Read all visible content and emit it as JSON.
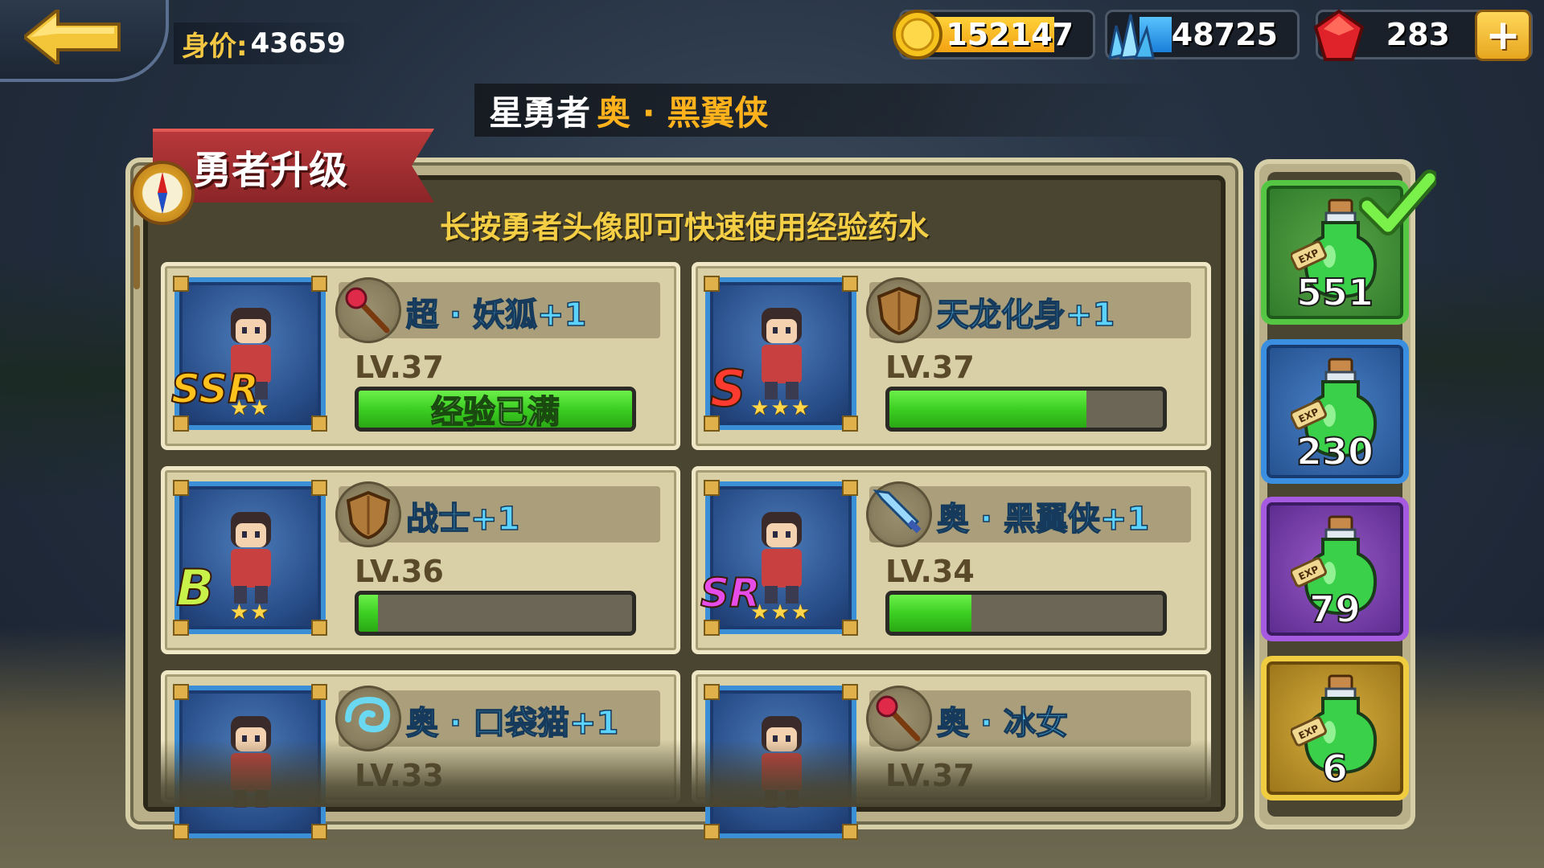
{
  "top_bar": {
    "worth_label": "身价:",
    "worth_value": "43659",
    "gold": "152147",
    "crystal": "48725",
    "ruby": "283",
    "plus_label": "+"
  },
  "hero_title": {
    "prefix": "星勇者",
    "name": "奥 · 黑翼侠"
  },
  "panel": {
    "ribbon_title": "勇者升级",
    "hint": "长按勇者头像即可快速使用经验药水"
  },
  "heroes": [
    {
      "rank": "SSR",
      "stars": "★★",
      "name": "超 · 妖狐+1",
      "level": "LV.37",
      "exp_text": "经验已满",
      "exp_fraction": 1.0,
      "equip": "staff-icon"
    },
    {
      "rank": "S",
      "stars": "★★★",
      "name": "天龙化身+1",
      "level": "LV.37",
      "exp_text": "",
      "exp_fraction": 0.72,
      "equip": "shield-icon"
    },
    {
      "rank": "B",
      "stars": "★★",
      "name": "战士+1",
      "level": "LV.36",
      "exp_text": "",
      "exp_fraction": 0.07,
      "equip": "shield-icon"
    },
    {
      "rank": "SR",
      "stars": "★★★",
      "name": "奥 · 黑翼侠+1",
      "level": "LV.34",
      "exp_text": "",
      "exp_fraction": 0.3,
      "equip": "sword-icon"
    },
    {
      "rank": "",
      "stars": "",
      "name": "奥 · 口袋猫+1",
      "level": "LV.33",
      "exp_text": "",
      "exp_fraction": null,
      "equip": "wind-icon"
    },
    {
      "rank": "",
      "stars": "",
      "name": "奥 · 冰女",
      "level": "LV.37",
      "exp_text": "",
      "exp_fraction": null,
      "equip": "staff-icon"
    }
  ],
  "potions": [
    {
      "count": "551",
      "label": "EXP",
      "color": "#55c544",
      "selected": true
    },
    {
      "count": "230",
      "label": "EXP",
      "color": "#3a8fe0",
      "selected": false
    },
    {
      "count": "79",
      "label": "EXP",
      "color": "#a65ae0",
      "selected": false
    },
    {
      "count": "6",
      "label": "EXP",
      "color": "#f0cc40",
      "selected": false
    }
  ],
  "colors": {
    "accent_gold": "#f4cf45",
    "hero_name": "#5cd2ff",
    "exp_green": "#3ccf22",
    "ribbon_red": "#b8383a"
  }
}
